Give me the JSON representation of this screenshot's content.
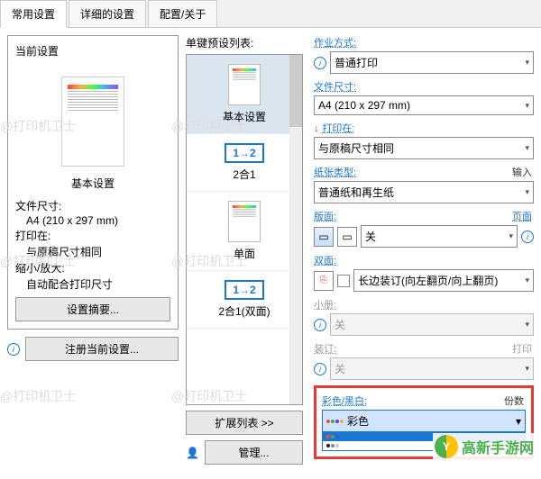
{
  "tabs": [
    "常用设置",
    "详细的设置",
    "配置/关于"
  ],
  "left": {
    "title": "当前设置",
    "caption": "基本设置",
    "info": [
      {
        "label": "文件尺寸:",
        "val": "A4 (210 x 297 mm)"
      },
      {
        "label": "打印在:",
        "val": "与原稿尺寸相同"
      },
      {
        "label": "缩小/放大:",
        "val": "自动配合打印尺寸"
      }
    ],
    "summary_btn": "设置摘要...",
    "register_btn": "注册当前设置..."
  },
  "mid": {
    "title": "单键预设列表:",
    "items": [
      "基本设置",
      "2合1",
      "单面",
      "2合1(双面)"
    ],
    "badge12": "1→2",
    "expand_btn": "扩展列表 >>",
    "manage_btn": "管理..."
  },
  "right": {
    "jobmode": {
      "label": "作业方式:",
      "val": "普通打印"
    },
    "docsize": {
      "label": "文件尺寸:",
      "val": "A4 (210 x 297 mm)"
    },
    "printon": {
      "label": "打印在:",
      "val": "与原稿尺寸相同"
    },
    "paper": {
      "label": "纸张类型:",
      "val": "普通纸和再生纸"
    },
    "input_label": "输入",
    "layout": {
      "label": "版面:",
      "val": "关"
    },
    "page_label": "页面",
    "duplex": {
      "label": "双面:",
      "val": "长边装订(向左翻页/向上翻页)"
    },
    "booklet": {
      "label": "小册:",
      "val": "关"
    },
    "binding": {
      "label": "装订:",
      "val": "关"
    },
    "print_label": "打印",
    "color": {
      "label": "彩色/黑白:",
      "val": "彩色"
    },
    "copies_label": "份数"
  },
  "logo_text": "高新手游网"
}
